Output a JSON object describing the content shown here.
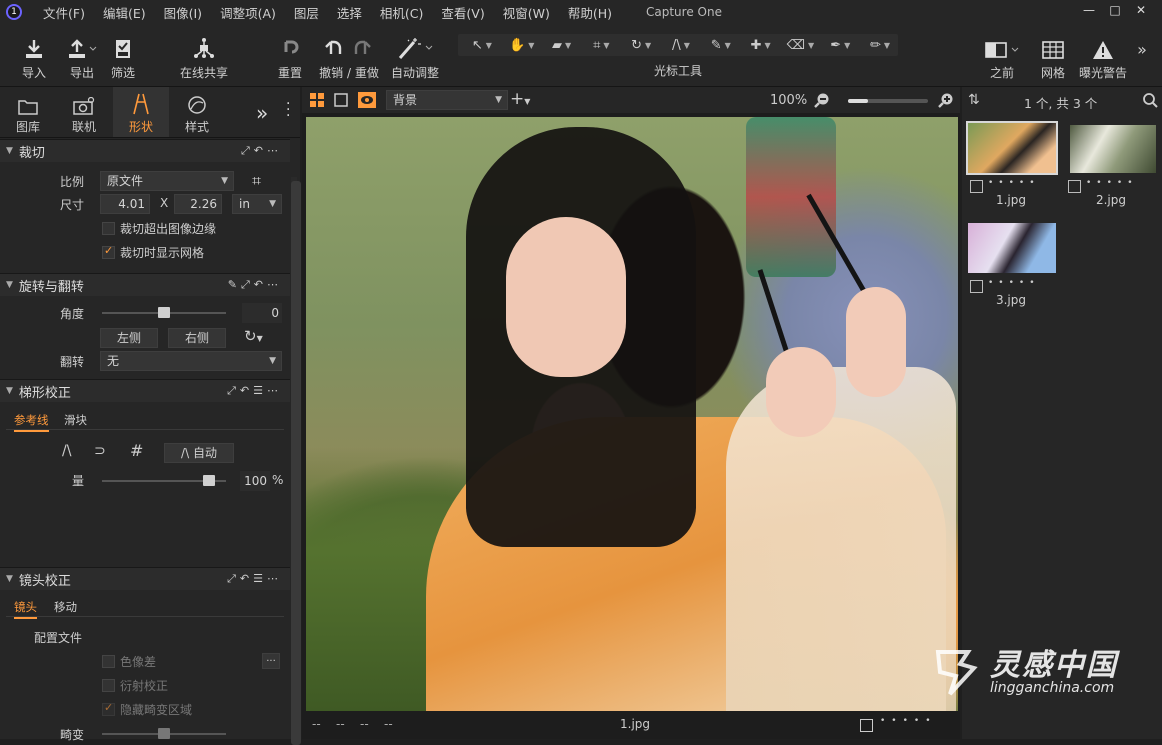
{
  "app": {
    "title": "Capture One"
  },
  "menu": [
    "文件(F)",
    "编辑(E)",
    "图像(I)",
    "调整项(A)",
    "图层",
    "选择",
    "相机(C)",
    "查看(V)",
    "视窗(W)",
    "帮助(H)"
  ],
  "window_controls": [
    "—",
    "□",
    "✕"
  ],
  "toolbar": {
    "import": "导入",
    "export": "导出",
    "filter": "筛选",
    "live_share": "在线共享",
    "reset": "重置",
    "undo_redo": "撤销 / 重做",
    "auto_adjust": "自动调整",
    "cursor_tools": "光标工具",
    "before": "之前",
    "grid": "网格",
    "exposure_warning": "曝光警告"
  },
  "tool_tabs": [
    {
      "label": "图库"
    },
    {
      "label": "联机"
    },
    {
      "label": "形状"
    },
    {
      "label": "样式"
    }
  ],
  "crop": {
    "title": "裁切",
    "ratio_label": "比例",
    "ratio_value": "原文件",
    "size_label": "尺寸",
    "width": "4.01",
    "x": "X",
    "height": "2.26",
    "unit": "in",
    "crop_outside": "裁切超出图像边缘",
    "show_grid": "裁切时显示网格"
  },
  "rotate": {
    "title": "旋转与翻转",
    "angle_label": "角度",
    "angle_value": "0",
    "angle_fraction": 0.5,
    "left": "左侧",
    "right": "右侧",
    "flip_label": "翻转",
    "flip_value": "无"
  },
  "keystone": {
    "title": "梯形校正",
    "tab_guides": "参考线",
    "tab_sliders": "滑块",
    "auto": "自动",
    "amount_label": "量",
    "amount_value": "100",
    "amount_unit": "%",
    "amount_fraction": 0.9
  },
  "lens": {
    "title": "镜头校正",
    "tab_lens": "镜头",
    "tab_move": "移动",
    "profile_label": "配置文件",
    "chromatic": "色像差",
    "diffraction": "衍射校正",
    "hide_distortion": "隐藏畸变区域",
    "distortion_label": "畸变",
    "more": "..."
  },
  "viewer": {
    "background": "背景",
    "zoom": "100%",
    "filename": "1.jpg",
    "meta": [
      "--",
      "--",
      "--",
      "--"
    ]
  },
  "browser": {
    "count": "1 个, 共 3 个",
    "items": [
      {
        "name": "1.jpg"
      },
      {
        "name": "2.jpg"
      },
      {
        "name": "3.jpg"
      }
    ]
  },
  "watermark": {
    "brand": "灵感中国",
    "url": "lingganchina.com"
  },
  "colors": {
    "accent": "#ff9a3c",
    "panel": "#262626",
    "bg": "#1f1f1f"
  }
}
